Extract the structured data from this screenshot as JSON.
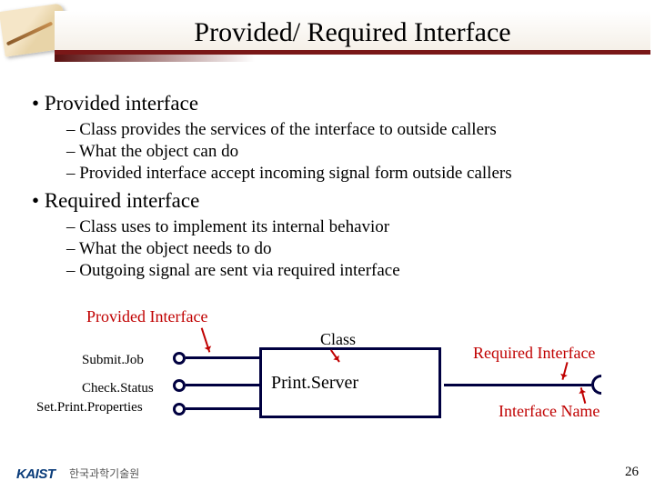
{
  "title": "Provided/ Required Interface",
  "bullets": {
    "provided": {
      "heading": "Provided interface",
      "items": [
        "Class provides the services of the interface to outside callers",
        "What the object can do",
        "Provided interface accept incoming signal form outside callers"
      ]
    },
    "required": {
      "heading": "Required interface",
      "items": [
        "Class uses to implement its internal behavior",
        "What the object needs to do",
        "Outgoing signal are sent via required interface"
      ]
    }
  },
  "diagram": {
    "provided_label": "Provided Interface",
    "class_label": "Class",
    "required_label": "Required Interface",
    "interface_name_label": "Interface Name",
    "class_name": "Print.Server",
    "ports": {
      "submit": "Submit.Job",
      "check": "Check.Status",
      "setprops": "Set.Print.Properties"
    }
  },
  "footer": {
    "kaist": "KAIST",
    "korean": "한국과학기술원",
    "page": "26"
  }
}
